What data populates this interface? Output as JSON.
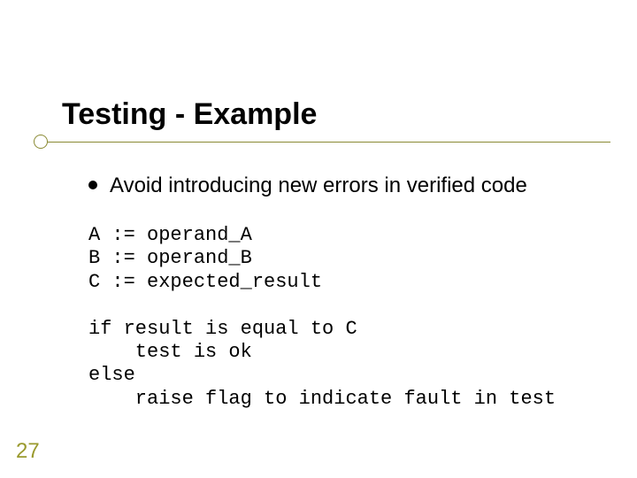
{
  "slide": {
    "title": "Testing - Example",
    "bullet": "Avoid introducing new errors in verified code",
    "code": "A := operand_A\nB := operand_B\nC := expected_result\n\nif result is equal to C\n    test is ok\nelse\n    raise flag to indicate fault in test",
    "page_number": "27"
  }
}
